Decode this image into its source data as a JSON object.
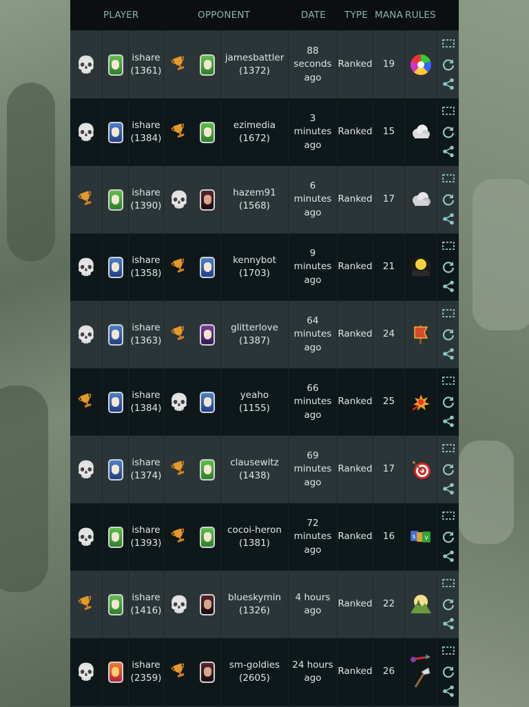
{
  "header": {
    "player": "PLAYER",
    "opponent": "OPPONENT",
    "date": "DATE",
    "type": "TYPE",
    "mana": "MANA",
    "rules": "RULES"
  },
  "battles": [
    {
      "player_result": "loss",
      "player_avatar": "green",
      "player_name": "ishare",
      "player_rating": "(1361)",
      "opp_result": "win",
      "opp_avatar": "green",
      "opp_name": "jamesbattler",
      "opp_rating": "(1372)",
      "date": "88 seconds ago",
      "type": "Ranked",
      "mana": "19",
      "rule_icon": "color-wheel-icon"
    },
    {
      "player_result": "loss",
      "player_avatar": "blue",
      "player_name": "ishare",
      "player_rating": "(1384)",
      "opp_result": "win",
      "opp_avatar": "green",
      "opp_name": "ezimedia",
      "opp_rating": "(1672)",
      "date": "3 minutes ago",
      "type": "Ranked",
      "mana": "15",
      "rule_icon": "cloud-icon"
    },
    {
      "player_result": "win",
      "player_avatar": "green",
      "player_name": "ishare",
      "player_rating": "(1390)",
      "opp_result": "loss",
      "opp_avatar": "dark",
      "opp_name": "hazem91",
      "opp_rating": "(1568)",
      "date": "6 minutes ago",
      "type": "Ranked",
      "mana": "17",
      "rule_icon": "fog-icon"
    },
    {
      "player_result": "loss",
      "player_avatar": "blue",
      "player_name": "ishare",
      "player_rating": "(1358)",
      "opp_result": "win",
      "opp_avatar": "blue",
      "opp_name": "kennybot",
      "opp_rating": "(1703)",
      "date": "9 minutes ago",
      "type": "Ranked",
      "mana": "21",
      "rule_icon": "night-moon-icon"
    },
    {
      "player_result": "loss",
      "player_avatar": "blue",
      "player_name": "ishare",
      "player_rating": "(1363)",
      "opp_result": "win",
      "opp_avatar": "purple",
      "opp_name": "glitterlove",
      "opp_rating": "(1387)",
      "date": "64 minutes ago",
      "type": "Ranked",
      "mana": "24",
      "rule_icon": "banner-icon"
    },
    {
      "player_result": "win",
      "player_avatar": "blue",
      "player_name": "ishare",
      "player_rating": "(1384)",
      "opp_result": "loss",
      "opp_avatar": "blue",
      "opp_name": "yeaho",
      "opp_rating": "(1155)",
      "date": "66 minutes ago",
      "type": "Ranked",
      "mana": "25",
      "rule_icon": "explosion-icon"
    },
    {
      "player_result": "loss",
      "player_avatar": "blue",
      "player_name": "ishare",
      "player_rating": "(1374)",
      "opp_result": "win",
      "opp_avatar": "green",
      "opp_name": "clausewitz",
      "opp_rating": "(1438)",
      "date": "69 minutes ago",
      "type": "Ranked",
      "mana": "17",
      "rule_icon": "target-icon"
    },
    {
      "player_result": "loss",
      "player_avatar": "green",
      "player_name": "ishare",
      "player_rating": "(1393)",
      "opp_result": "win",
      "opp_avatar": "green",
      "opp_name": "cocoi-heron",
      "opp_rating": "(1381)",
      "date": "72 minutes ago",
      "type": "Ranked",
      "mana": "16",
      "rule_icon": "cards-icon"
    },
    {
      "player_result": "win",
      "player_avatar": "green",
      "player_name": "ishare",
      "player_rating": "(1416)",
      "opp_result": "loss",
      "opp_avatar": "dark",
      "opp_name": "blueskymin",
      "opp_rating": "(1326)",
      "date": "4 hours ago",
      "type": "Ranked",
      "mana": "22",
      "rule_icon": "mountain-icon"
    },
    {
      "player_result": "loss",
      "player_avatar": "red",
      "player_name": "ishare",
      "player_rating": "(2359)",
      "opp_result": "win",
      "opp_avatar": "dark",
      "opp_name": "sm-goldies",
      "opp_rating": "(2605)",
      "date": "24 hours ago",
      "type": "Ranked",
      "mana": "26",
      "rule_icon": "arrow-axe-icon"
    }
  ],
  "colors": {
    "header_bg": "#0b0f10",
    "header_text": "#8fb2b1",
    "row_odd": "#2b3538",
    "row_even": "#0e1719",
    "action_icon": "#8fc6c8",
    "trophy": "#e08a1e"
  }
}
